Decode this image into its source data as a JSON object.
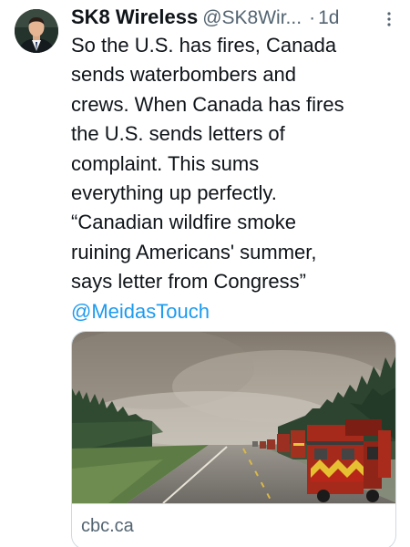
{
  "tweet": {
    "author": {
      "display_name": "SK8 Wireless",
      "handle": "@SK8Wir...",
      "separator": "·",
      "time": "1d",
      "avatar_icon": "profile-photo"
    },
    "more_icon": "more-vertical-icon",
    "text_lines": [
      "So the U.S. has fires, Canada",
      "sends waterbombers and",
      "crews.  When Canada has fires",
      "the U.S. sends letters of",
      "complaint.  This sums",
      "everything up perfectly.",
      "“Canadian wildfire smoke",
      "ruining Americans' summer,",
      "says letter from Congress”"
    ],
    "mention": "@MeidasTouch",
    "link_color": "#1d9bf0",
    "card": {
      "domain": "cbc.ca",
      "image_alt": "wildfire-smoke-highway-fire-trucks"
    }
  }
}
